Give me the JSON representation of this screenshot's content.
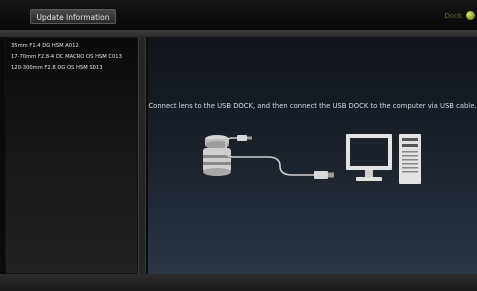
{
  "toolbar": {
    "update_button_label": "Update Information",
    "dock_label": "Dock"
  },
  "sidebar": {
    "lenses": [
      "35mm F1.4 DG HSM A012",
      "17-70mm F2.8-4 DC MACRO OS HSM C013",
      "120-300mm F2.8 DG OS HSM S013"
    ]
  },
  "main": {
    "instruction": "Connect lens to the USB DOCK, and then connect the USB DOCK to the computer via USB cable."
  },
  "colors": {
    "dock_status_led": "#9aaa2a",
    "main_panel": "#1e2733"
  },
  "icons": [
    "usb-dock-with-lens-icon",
    "usb-cable-icon",
    "monitor-icon",
    "computer-tower-icon"
  ]
}
